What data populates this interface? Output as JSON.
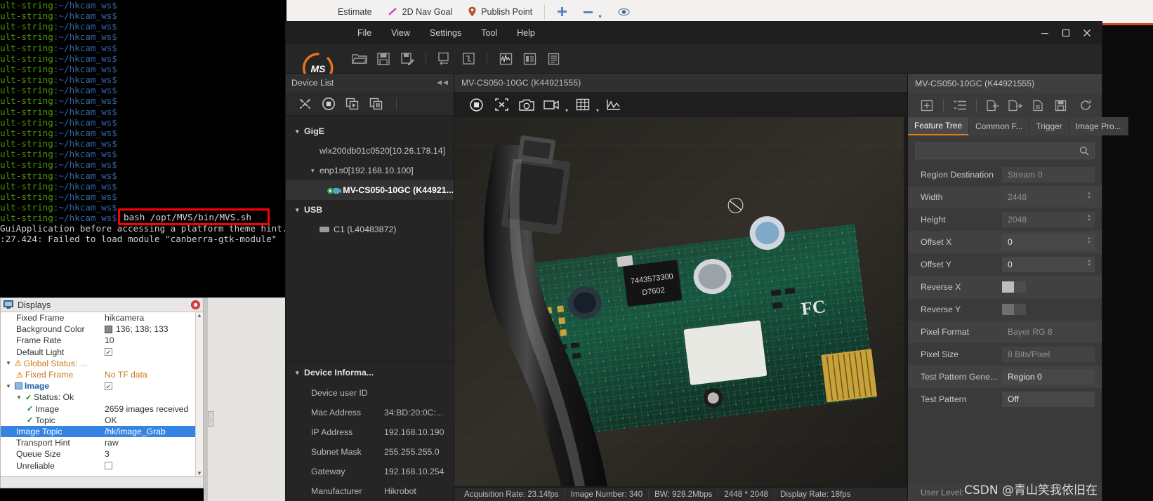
{
  "terminal": {
    "prompt_user": "ult-string",
    "prompt_path": ":~/hkcam_ws$",
    "prompt_line_count": 21,
    "highlighted_command": "bash /opt/MVS/bin/MVS.sh",
    "log_line_1": "GuiApplication before accessing a platform theme hint.",
    "log_line_2": ":27.424: Failed to load module \"canberra-gtk-module\"",
    "highlight_color": "#ff0000"
  },
  "rviz": {
    "toolbar": [
      {
        "label": "Estimate",
        "icon": ""
      },
      {
        "label": "2D Nav Goal",
        "icon": "nav-goal-icon"
      },
      {
        "label": "Publish Point",
        "icon": "publish-point-icon"
      }
    ],
    "toolbar_icons": [
      {
        "name": "add-icon",
        "glyph": "+"
      },
      {
        "name": "remove-icon",
        "glyph": "−"
      },
      {
        "name": "eye-icon",
        "glyph": "◉"
      }
    ],
    "displays": {
      "title": "Displays",
      "rows": [
        {
          "indent": 2,
          "label": "Fixed Frame",
          "value": "hikcamera",
          "kind": "text"
        },
        {
          "indent": 2,
          "label": "Background Color",
          "value": "136; 138; 133",
          "kind": "color"
        },
        {
          "indent": 2,
          "label": "Frame Rate",
          "value": "10",
          "kind": "text"
        },
        {
          "indent": 2,
          "label": "Default Light",
          "value": "✓",
          "kind": "check"
        },
        {
          "indent": 1,
          "label": "Global Status: ...",
          "value": "",
          "kind": "warn-group"
        },
        {
          "indent": 2,
          "label": "Fixed Frame",
          "value": "No TF data",
          "kind": "warn"
        },
        {
          "indent": 1,
          "label": "Image",
          "value": "✓",
          "kind": "image-group"
        },
        {
          "indent": 2,
          "label": "Status: Ok",
          "value": "",
          "kind": "ok-group"
        },
        {
          "indent": 3,
          "label": "Image",
          "value": "2659 images received",
          "kind": "ok"
        },
        {
          "indent": 3,
          "label": "Topic",
          "value": "OK",
          "kind": "ok"
        },
        {
          "indent": 2,
          "label": "Image Topic",
          "value": "/hk/image_Grab",
          "kind": "selected"
        },
        {
          "indent": 2,
          "label": "Transport Hint",
          "value": "raw",
          "kind": "text"
        },
        {
          "indent": 2,
          "label": "Queue Size",
          "value": "3",
          "kind": "text"
        },
        {
          "indent": 2,
          "label": "Unreliable",
          "value": "",
          "kind": "uncheck"
        }
      ]
    }
  },
  "mvs": {
    "menu": [
      "File",
      "View",
      "Settings",
      "Tool",
      "Help"
    ],
    "window_buttons": [
      {
        "name": "minimize-button",
        "glyph": "—"
      },
      {
        "name": "maximize-button",
        "glyph": "☐"
      },
      {
        "name": "close-button",
        "glyph": "✕"
      }
    ],
    "toolbar_icons": [
      "open-folder-icon",
      "save-icon",
      "save-as-icon",
      "import-config-icon",
      "export-config-icon",
      "waveform-icon",
      "stats-icon",
      "log-icon"
    ],
    "device_list": {
      "title": "Device List",
      "collapse_icon": "collapse-left-icon",
      "tool_icons": [
        "refresh-devices-icon",
        "stop-icon",
        "start-all-icon",
        "stop-all-icon"
      ],
      "tree": [
        {
          "level": 0,
          "type": "group",
          "label": "GigE",
          "expanded": true
        },
        {
          "level": 1,
          "type": "nic",
          "label": "wlx200db01c0520[10.26.178.14]",
          "expanded": false
        },
        {
          "level": 1,
          "type": "nic",
          "label": "enp1s0[192.168.10.100]",
          "expanded": true
        },
        {
          "level": 2,
          "type": "camera",
          "label": "MV-CS050-10GC (K44921...",
          "selected": true
        },
        {
          "level": 0,
          "type": "group",
          "label": "USB",
          "expanded": true
        },
        {
          "level": 1,
          "type": "usb",
          "label": "C1 (L40483872)",
          "selected": false
        }
      ]
    },
    "device_information": {
      "title": "Device Informa...",
      "rows": [
        {
          "key": "Device user ID",
          "value": ""
        },
        {
          "key": "Mac Address",
          "value": "34:BD:20:0C:..."
        },
        {
          "key": "IP Address",
          "value": "192.168.10.190"
        },
        {
          "key": "Subnet Mask",
          "value": "255.255.255.0"
        },
        {
          "key": "Gateway",
          "value": "192.168.10.254"
        },
        {
          "key": "Manufacturer",
          "value": "Hikrobot"
        }
      ]
    },
    "viewer": {
      "title": "MV-CS050-10GC (K44921555)",
      "tool_icons": [
        "start-grabbing-icon",
        "stop-grabbing-icon",
        "snapshot-icon",
        "record-video-icon",
        "grid-overlay-icon",
        "histogram-icon"
      ],
      "status": [
        "Acquisition Rate: 23.14fps",
        "Image Number: 340",
        "BW: 928.2Mbps",
        "2448 * 2048",
        "Display Rate: 18fps"
      ]
    },
    "properties": {
      "title": "MV-CS050-10GC (K44921555)",
      "tool_icons": [
        "layout-icon",
        "list-icon",
        "import-feature-icon",
        "export-feature-icon",
        "file-icon",
        "save-icon",
        "refresh-icon"
      ],
      "tabs": [
        {
          "label": "Feature Tree",
          "active": true
        },
        {
          "label": "Common F...",
          "active": false
        },
        {
          "label": "Trigger",
          "active": false
        },
        {
          "label": "Image Pro...",
          "active": false
        }
      ],
      "search_placeholder": "",
      "search_icon": "search-icon",
      "rows": [
        {
          "key": "Region Destination",
          "value": "Stream 0",
          "kind": "readonly-combo"
        },
        {
          "key": "Width",
          "value": "2448",
          "kind": "readonly-spin"
        },
        {
          "key": "Height",
          "value": "2048",
          "kind": "readonly-spin"
        },
        {
          "key": "Offset X",
          "value": "0",
          "kind": "spin"
        },
        {
          "key": "Offset Y",
          "value": "0",
          "kind": "spin"
        },
        {
          "key": "Reverse X",
          "value": "on",
          "kind": "toggle-on"
        },
        {
          "key": "Reverse Y",
          "value": "off",
          "kind": "toggle-off"
        },
        {
          "key": "Pixel Format",
          "value": "Bayer RG 8",
          "kind": "readonly-combo"
        },
        {
          "key": "Pixel Size",
          "value": "8 Bits/Pixel",
          "kind": "readonly-combo"
        },
        {
          "key": "Test Pattern Gene...",
          "value": "Region 0",
          "kind": "combo"
        },
        {
          "key": "Test Pattern",
          "value": "Off",
          "kind": "combo"
        }
      ],
      "footer_label": "User Level:",
      "accent_color": "#e07b1e"
    },
    "watermark": "CSDN @青山笑我依旧在"
  }
}
